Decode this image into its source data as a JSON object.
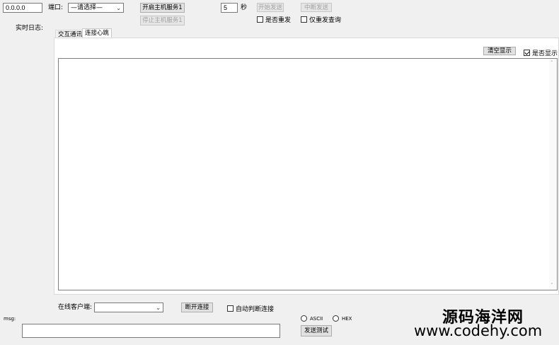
{
  "top": {
    "ip_value": "0.0.0.0",
    "port_label": "端口:",
    "port_select": "—请选择—",
    "start_service": "开启主机服务1",
    "stop_service": "停止主机服务1",
    "interval_value": "5",
    "seconds_label": "秒",
    "start_send": "开始发送",
    "stop_send": "中断发送",
    "resend_label": "是否重发",
    "resend_only_query_label": "仅重发查询"
  },
  "log": {
    "label": "实时日志:",
    "tabs": [
      {
        "label": "交互通讯",
        "active": false
      },
      {
        "label": "连接心跳",
        "active": true
      }
    ],
    "clear_button": "清空显示",
    "show_label": "是否显示",
    "show_checked": true
  },
  "bottom": {
    "online_clients_label": "在线客户端:",
    "client_select": "",
    "disconnect_button": "断开连接",
    "auto_disconnect_label": "自动判断连接",
    "msg_label": "msg:",
    "msg_value": "",
    "ascii_label": "ASCII",
    "hex_label": "HEX",
    "send_test_button": "发送测试"
  },
  "watermark": {
    "line1": "源码海洋网",
    "line2": "www.codehy.com"
  }
}
